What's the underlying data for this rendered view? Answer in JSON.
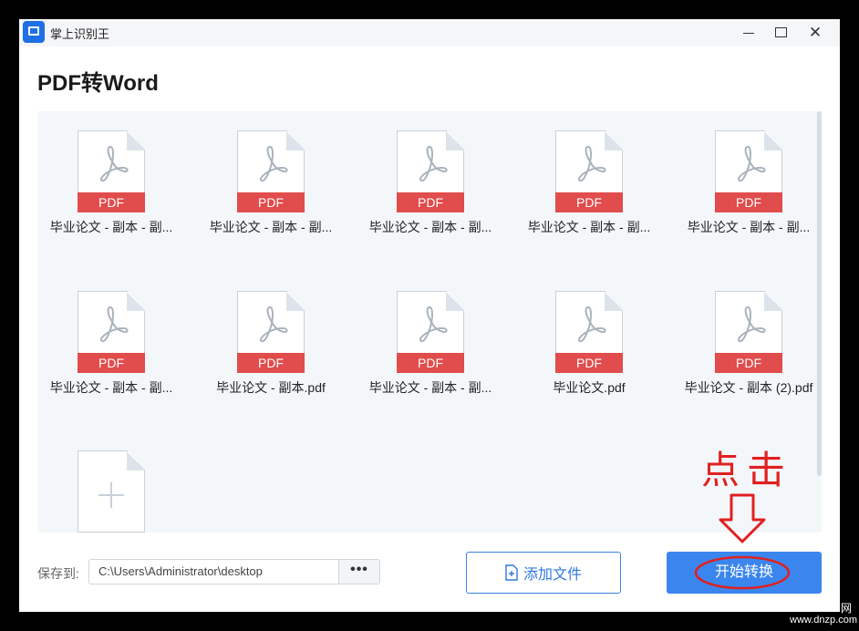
{
  "window": {
    "app_title": "掌上识别王",
    "page_title": "PDF转Word"
  },
  "files": [
    {
      "badge": "PDF",
      "name": "毕业论文 - 副本 - 副..."
    },
    {
      "badge": "PDF",
      "name": "毕业论文 - 副本 - 副..."
    },
    {
      "badge": "PDF",
      "name": "毕业论文 - 副本 - 副..."
    },
    {
      "badge": "PDF",
      "name": "毕业论文 - 副本 - 副..."
    },
    {
      "badge": "PDF",
      "name": "毕业论文 - 副本 - 副..."
    },
    {
      "badge": "PDF",
      "name": "毕业论文 - 副本 - 副..."
    },
    {
      "badge": "PDF",
      "name": "毕业论文 - 副本.pdf"
    },
    {
      "badge": "PDF",
      "name": "毕业论文 - 副本 - 副..."
    },
    {
      "badge": "PDF",
      "name": "毕业论文.pdf"
    },
    {
      "badge": "PDF",
      "name": "毕业论文 - 副本 (2).pdf"
    }
  ],
  "footer": {
    "save_label": "保存到:",
    "save_path": "C:\\Users\\Administrator\\desktop",
    "browse_label": "•••",
    "add_file_label": "添加文件",
    "start_label": "开始转换"
  },
  "annotation": {
    "text": "点击",
    "color": "#e02020"
  },
  "watermark": {
    "line1": "网",
    "line2": "www.dnzp.com"
  },
  "colors": {
    "accent": "#3b86ee",
    "pdf_badge": "#e14c4c"
  }
}
